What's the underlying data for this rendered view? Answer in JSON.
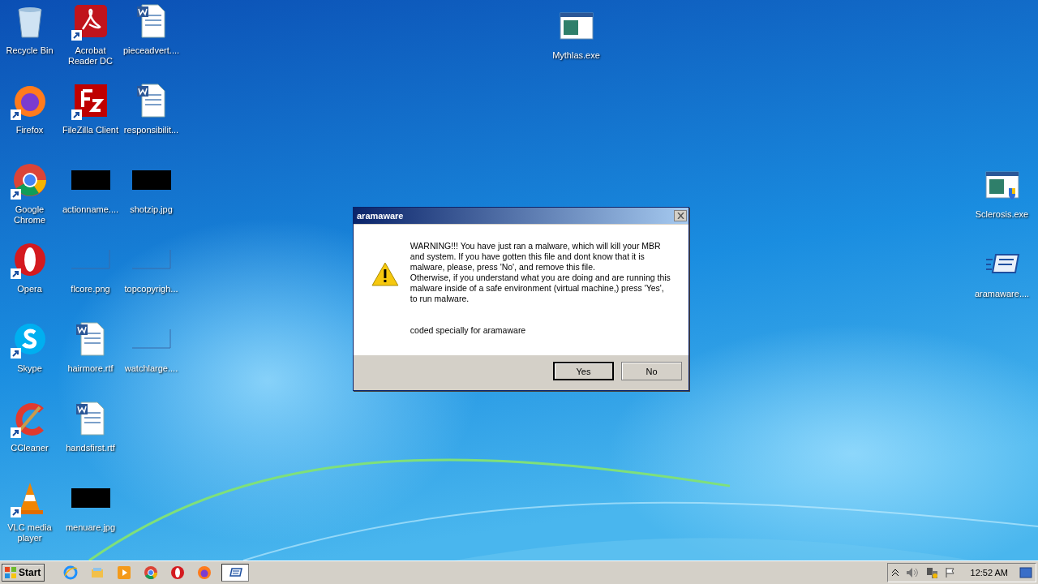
{
  "desktop_icons": [
    {
      "label": "Recycle Bin",
      "kind": "recycle",
      "shortcut": false
    },
    {
      "label": "Firefox",
      "kind": "firefox",
      "shortcut": true
    },
    {
      "label": "Google Chrome",
      "kind": "chrome",
      "shortcut": true
    },
    {
      "label": "Opera",
      "kind": "opera",
      "shortcut": true
    },
    {
      "label": "Skype",
      "kind": "skype",
      "shortcut": true
    },
    {
      "label": "CCleaner",
      "kind": "ccleaner",
      "shortcut": true
    },
    {
      "label": "VLC media player",
      "kind": "vlc",
      "shortcut": true
    },
    {
      "label": "Acrobat Reader DC",
      "kind": "acrobat",
      "shortcut": true
    },
    {
      "label": "FileZilla Client",
      "kind": "filezilla",
      "shortcut": true
    },
    {
      "label": "actionname....",
      "kind": "dark-image",
      "shortcut": false
    },
    {
      "label": "flcore.png",
      "kind": "blank-image",
      "shortcut": false
    },
    {
      "label": "hairmore.rtf",
      "kind": "document",
      "shortcut": false
    },
    {
      "label": "handsfirst.rtf",
      "kind": "document",
      "shortcut": false
    },
    {
      "label": "menuare.jpg",
      "kind": "dark-image",
      "shortcut": false
    },
    {
      "label": "pieceadvert....",
      "kind": "document",
      "shortcut": false
    },
    {
      "label": "responsibilit...",
      "kind": "document",
      "shortcut": false
    },
    {
      "label": "shotzip.jpg",
      "kind": "dark-image",
      "shortcut": false
    },
    {
      "label": "topcopyrigh...",
      "kind": "blank-image",
      "shortcut": false
    },
    {
      "label": "watchlarge....",
      "kind": "blank-image",
      "shortcut": false
    }
  ],
  "free_icons": [
    {
      "label": "Mythlas.exe",
      "kind": "program",
      "shortcut": false
    },
    {
      "label": "Sclerosis.exe",
      "kind": "program-shield",
      "shortcut": false
    },
    {
      "label": "aramaware....",
      "kind": "dialog-app",
      "shortcut": false
    }
  ],
  "dialog": {
    "title": "aramaware",
    "message": [
      "WARNING!!! You have just ran a malware, which will kill your MBR and system. If you have gotten this file and dont know that it is malware, please, press 'No', and remove this file.",
      "Otherwise, if you understand what you are doing and are running this malware inside of a safe environment (virtual machine,) press 'Yes', to run malware."
    ],
    "note": "coded specially for aramaware",
    "buttons": [
      {
        "label": "Yes",
        "selected": true
      },
      {
        "label": "No",
        "selected": false
      }
    ]
  },
  "taskbar": {
    "start": "Start",
    "apps": [
      {
        "kind": "ie",
        "selected": false
      },
      {
        "kind": "explorer",
        "selected": false
      },
      {
        "kind": "media",
        "selected": false
      },
      {
        "kind": "chrome",
        "selected": false
      },
      {
        "kind": "opera",
        "selected": false
      },
      {
        "kind": "firefox",
        "selected": false
      },
      {
        "kind": "dialog-app",
        "selected": true
      }
    ],
    "clock": "12:52 AM"
  }
}
